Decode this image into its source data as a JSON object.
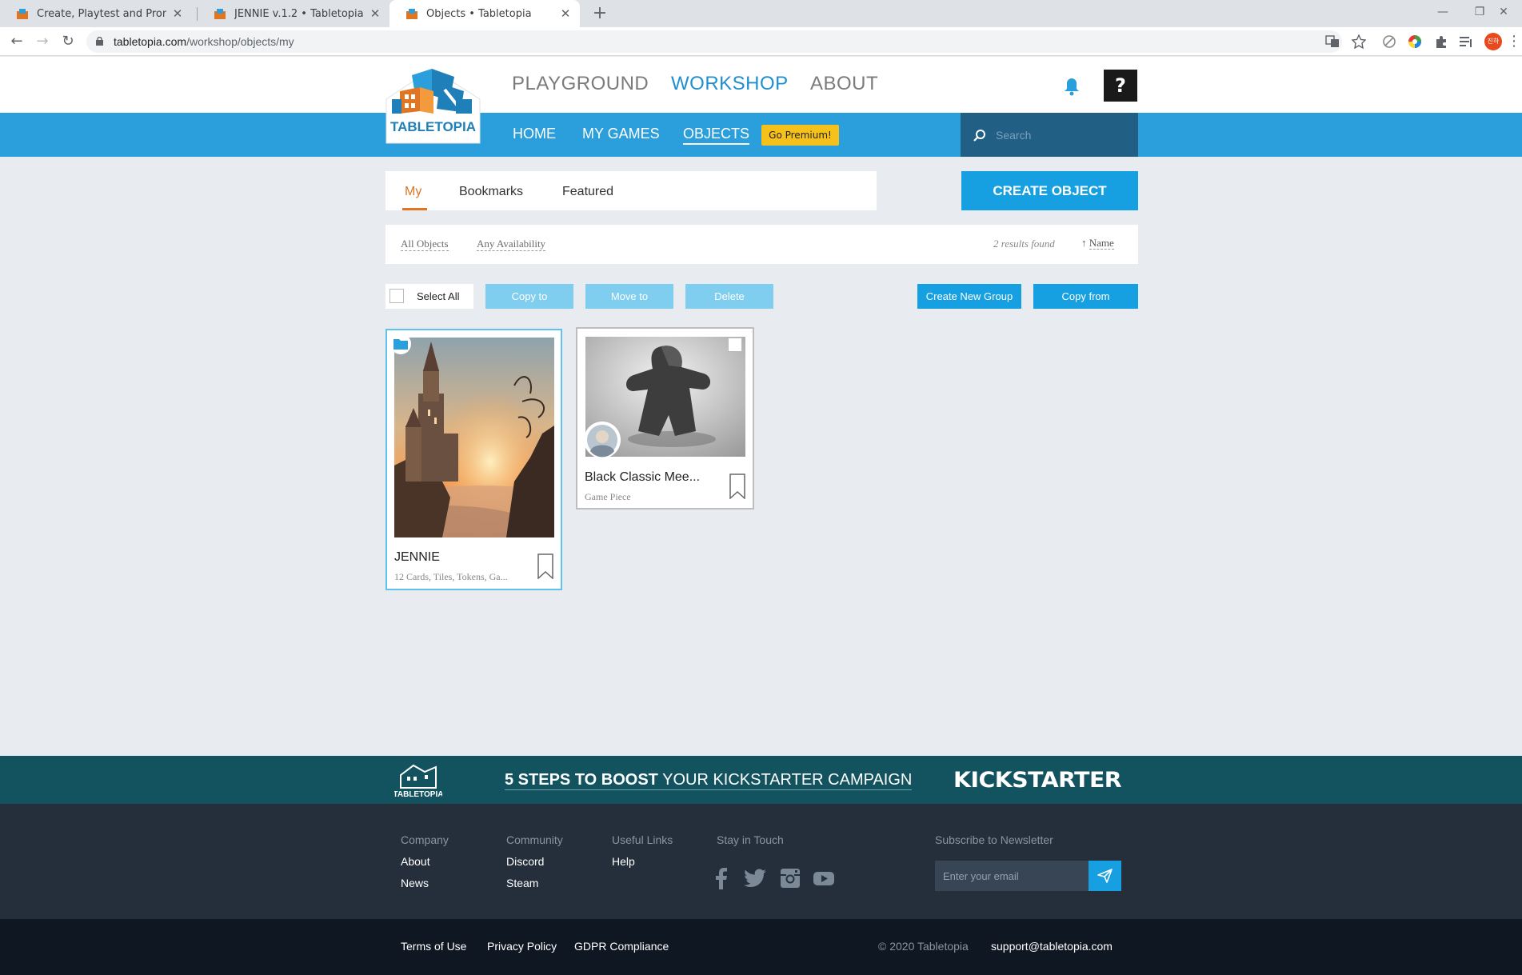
{
  "browser": {
    "tabs": [
      {
        "title": "Create, Playtest and Promote O",
        "active": false
      },
      {
        "title": "JENNIE v.1.2 • Tabletopia",
        "active": false
      },
      {
        "title": "Objects • Tabletopia",
        "active": true
      }
    ],
    "url_domain": "tabletopia.com",
    "url_path": "/workshop/objects/my",
    "profile_initials": "진하"
  },
  "header": {
    "logo_text": "TABLETOPIA",
    "main_nav": [
      "PLAYGROUND",
      "WORKSHOP",
      "ABOUT"
    ],
    "main_nav_active": "WORKSHOP",
    "help_label": "?",
    "sub_nav": [
      "HOME",
      "MY GAMES",
      "OBJECTS"
    ],
    "sub_nav_active": "OBJECTS",
    "premium_label": "Go Premium!",
    "search_placeholder": "Search"
  },
  "content": {
    "tabs": [
      "My",
      "Bookmarks",
      "Featured"
    ],
    "active_tab": "My",
    "create_label": "CREATE OBJECT",
    "filters": [
      "All Objects",
      "Any Availability"
    ],
    "results": "2 results found",
    "sort_label": "Name",
    "select_all": "Select All",
    "actions": {
      "copy_to": "Copy to",
      "move_to": "Move to",
      "delete": "Delete",
      "create_group": "Create New Group",
      "copy_from": "Copy from"
    },
    "cards": [
      {
        "title": "JENNIE",
        "subtitle": "12 Cards, Tiles, Tokens, Ga...",
        "kind": "folder"
      },
      {
        "title": "Black Classic Mee...",
        "subtitle": "Game Piece",
        "kind": "object"
      }
    ]
  },
  "promo": {
    "bold": "5 STEPS TO BOOST",
    "rest": " YOUR KICKSTARTER CAMPAIGN",
    "brand": "KICKSTARTER"
  },
  "footer": {
    "company": {
      "title": "Company",
      "links": [
        "About",
        "News"
      ]
    },
    "community": {
      "title": "Community",
      "links": [
        "Discord",
        "Steam"
      ]
    },
    "useful": {
      "title": "Useful Links",
      "links": [
        "Help"
      ]
    },
    "stay": {
      "title": "Stay in Touch"
    },
    "newsletter": {
      "title": "Subscribe to Newsletter",
      "placeholder": "Enter your email"
    },
    "bottom_links": [
      "Terms of Use",
      "Privacy Policy",
      "GDPR Compliance"
    ],
    "copyright": "© 2020 Tabletopia",
    "support": "support@tabletopia.com"
  },
  "colors": {
    "accent": "#16a0e2",
    "nav_blue": "#2a9fdc",
    "tab_orange": "#e07622",
    "premium": "#f7c11b",
    "promo": "#12535f",
    "footer": "#252f3b"
  },
  "icons": [
    "back-icon",
    "forward-icon",
    "reload-icon",
    "lock-icon",
    "translate-icon",
    "star-icon",
    "extension-icon",
    "bell-icon",
    "search-icon",
    "bookmark-icon",
    "facebook-icon",
    "twitter-icon",
    "instagram-icon",
    "youtube-icon",
    "send-icon"
  ]
}
